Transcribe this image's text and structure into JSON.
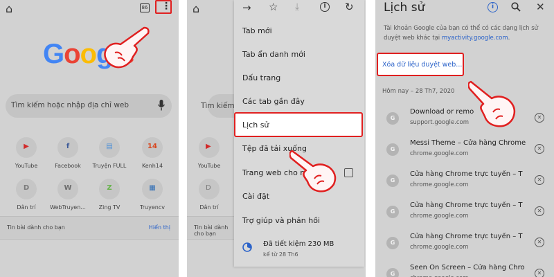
{
  "panel1": {
    "search_placeholder": "Tìm kiếm hoặc nhập địa chỉ web",
    "tab_count": "86",
    "logo": "Google",
    "shortcuts": [
      {
        "label": "YouTube",
        "glyph": "▶",
        "color": "#d22a2a"
      },
      {
        "label": "Facebook",
        "glyph": "f",
        "color": "#3b5998"
      },
      {
        "label": "Truyện FULL",
        "glyph": "▤",
        "color": "#4a8fd8"
      },
      {
        "label": "Kenh14",
        "glyph": "14",
        "color": "#d8461e"
      },
      {
        "label": "Dân trí",
        "glyph": "D",
        "color": "#7a7a7a"
      },
      {
        "label": "WebTruyen...",
        "glyph": "W",
        "color": "#6d6d6d"
      },
      {
        "label": "Zing TV",
        "glyph": "Z",
        "color": "#66b34a"
      },
      {
        "label": "Truyencv",
        "glyph": "▦",
        "color": "#2f6db5"
      }
    ],
    "feed_title": "Tin bài dành cho bạn",
    "feed_action": "Hiển thị"
  },
  "panel2": {
    "search_placeholder": "Tìm kiếm",
    "menu_items": [
      "Tab mới",
      "Tab ẩn danh mới",
      "Dấu trang",
      "Các tab gần đây",
      "Lịch sử",
      "Tệp đã tải xuống",
      "Trang web cho m",
      "Cài đặt",
      "Trợ giúp và phản hồi"
    ],
    "saved_main": "Đã tiết kiệm 230 MB",
    "saved_sub": "kể từ 28 Th6"
  },
  "panel3": {
    "title": "Lịch sử",
    "description_prefix": "Tài khoản Google của bạn có thể có các dạng lịch sử duyệt web khác tại",
    "description_link": "myactivity.google.com",
    "clear_button": "Xóa dữ liệu duyệt web...",
    "date_header": "Hôm nay – 28 Th7, 2020",
    "entries": [
      {
        "title": "Download or remo",
        "url": "support.google.com"
      },
      {
        "title": "Messi Theme – Cửa hàng Chrome",
        "url": "chrome.google.com"
      },
      {
        "title": "Cửa hàng Chrome trực tuyến – T",
        "url": "chrome.google.com"
      },
      {
        "title": "Cửa hàng Chrome trực tuyến – T",
        "url": "chrome.google.com"
      },
      {
        "title": "Cửa hàng Chrome trực tuyến – T",
        "url": "chrome.google.com"
      },
      {
        "title": "Seen On Screen – Cửa hàng Chro",
        "url": "chrome.google.com"
      }
    ]
  },
  "colors": {
    "highlight": "#e02020",
    "link": "#2a62c9"
  }
}
